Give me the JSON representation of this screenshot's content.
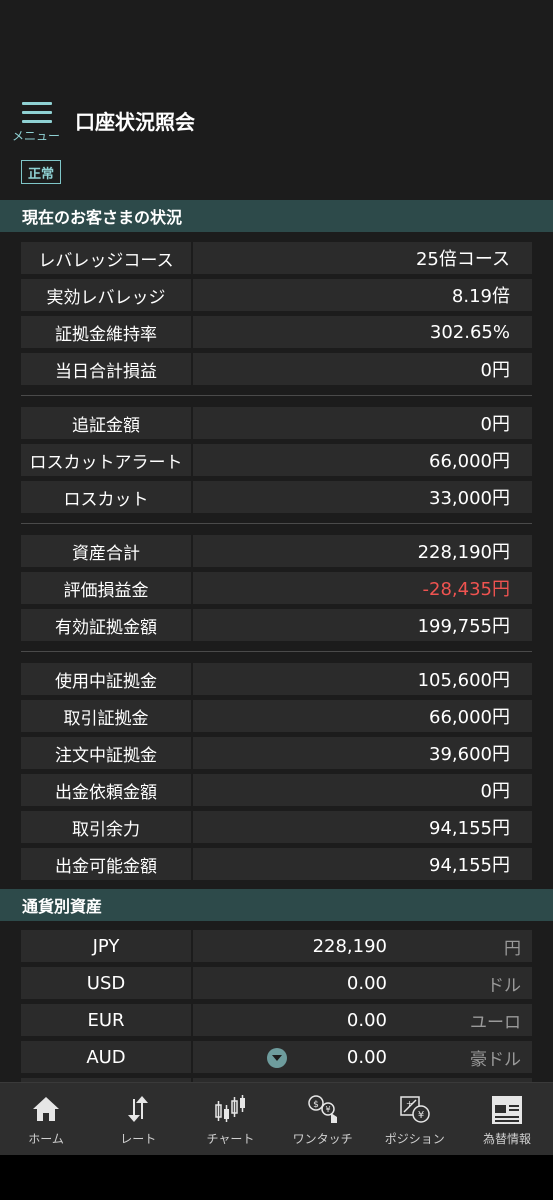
{
  "header": {
    "menu_label": "メニュー",
    "title": "口座状況照会"
  },
  "status_badge": "正常",
  "sections": {
    "customer_status": "現在のお客さまの状況",
    "currency_assets": "通貨別資産"
  },
  "rows": [
    {
      "label": "レバレッジコース",
      "value": "25倍コース"
    },
    {
      "label": "実効レバレッジ",
      "value": "8.19倍"
    },
    {
      "label": "証拠金維持率",
      "value": "302.65%"
    },
    {
      "label": "当日合計損益",
      "value": "0円"
    },
    {
      "label": "追証金額",
      "value": "0円"
    },
    {
      "label": "ロスカットアラート",
      "value": "66,000円"
    },
    {
      "label": "ロスカット",
      "value": "33,000円"
    },
    {
      "label": "資産合計",
      "value": "228,190円"
    },
    {
      "label": "評価損益金",
      "value": "-28,435円",
      "negative": true
    },
    {
      "label": "有効証拠金額",
      "value": "199,755円"
    },
    {
      "label": "使用中証拠金",
      "value": "105,600円"
    },
    {
      "label": "取引証拠金",
      "value": "66,000円"
    },
    {
      "label": "注文中証拠金",
      "value": "39,600円"
    },
    {
      "label": "出金依頼金額",
      "value": "0円"
    },
    {
      "label": "取引余力",
      "value": "94,155円"
    },
    {
      "label": "出金可能金額",
      "value": "94,155円"
    }
  ],
  "currencies": [
    {
      "code": "JPY",
      "amount": "228,190",
      "unit": "円"
    },
    {
      "code": "USD",
      "amount": "0.00",
      "unit": "ドル"
    },
    {
      "code": "EUR",
      "amount": "0.00",
      "unit": "ユーロ"
    },
    {
      "code": "AUD",
      "amount": "0.00",
      "unit": "豪ドル"
    }
  ],
  "nav": [
    {
      "label": "ホーム",
      "icon": "home-icon"
    },
    {
      "label": "レート",
      "icon": "rate-arrows-icon"
    },
    {
      "label": "チャート",
      "icon": "candlestick-chart-icon"
    },
    {
      "label": "ワンタッチ",
      "icon": "one-touch-icon"
    },
    {
      "label": "ポジション",
      "icon": "position-icon"
    },
    {
      "label": "為替情報",
      "icon": "news-icon"
    }
  ],
  "colors": {
    "background": "#1c1c1c",
    "cell": "#2b2b2b",
    "section_header": "#2d4a4a",
    "accent": "#8fd1d3",
    "negative": "#ef5350",
    "nav": "#2e2e2e"
  }
}
